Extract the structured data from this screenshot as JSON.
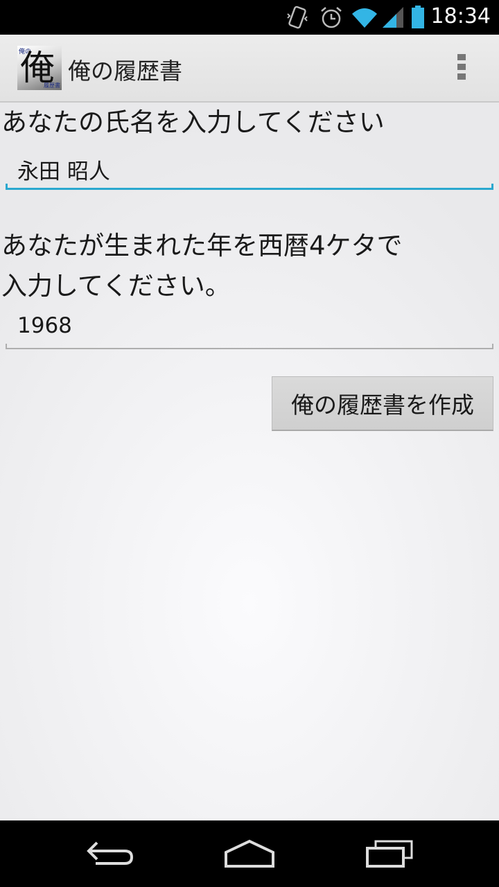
{
  "status_bar": {
    "time": "18:34",
    "icons": [
      "vibrate-icon",
      "alarm-icon",
      "wifi-icon",
      "signal-icon",
      "battery-icon"
    ]
  },
  "action_bar": {
    "title": "俺の履歴書",
    "app_icon": {
      "glyph": "俺",
      "top_text": "俺の",
      "bottom_text": "履歴書"
    }
  },
  "form": {
    "name_label": "あなたの氏名を入力してください",
    "name_value": "永田 昭人",
    "year_label": "あなたが生まれた年を西暦4ケタで\n入力してください。",
    "year_value": "1968",
    "submit_label": "俺の履歴書を作成"
  },
  "colors": {
    "focus_underline": "#2aa8cf",
    "battery": "#33b5e5",
    "wifi": "#33b5e5"
  }
}
